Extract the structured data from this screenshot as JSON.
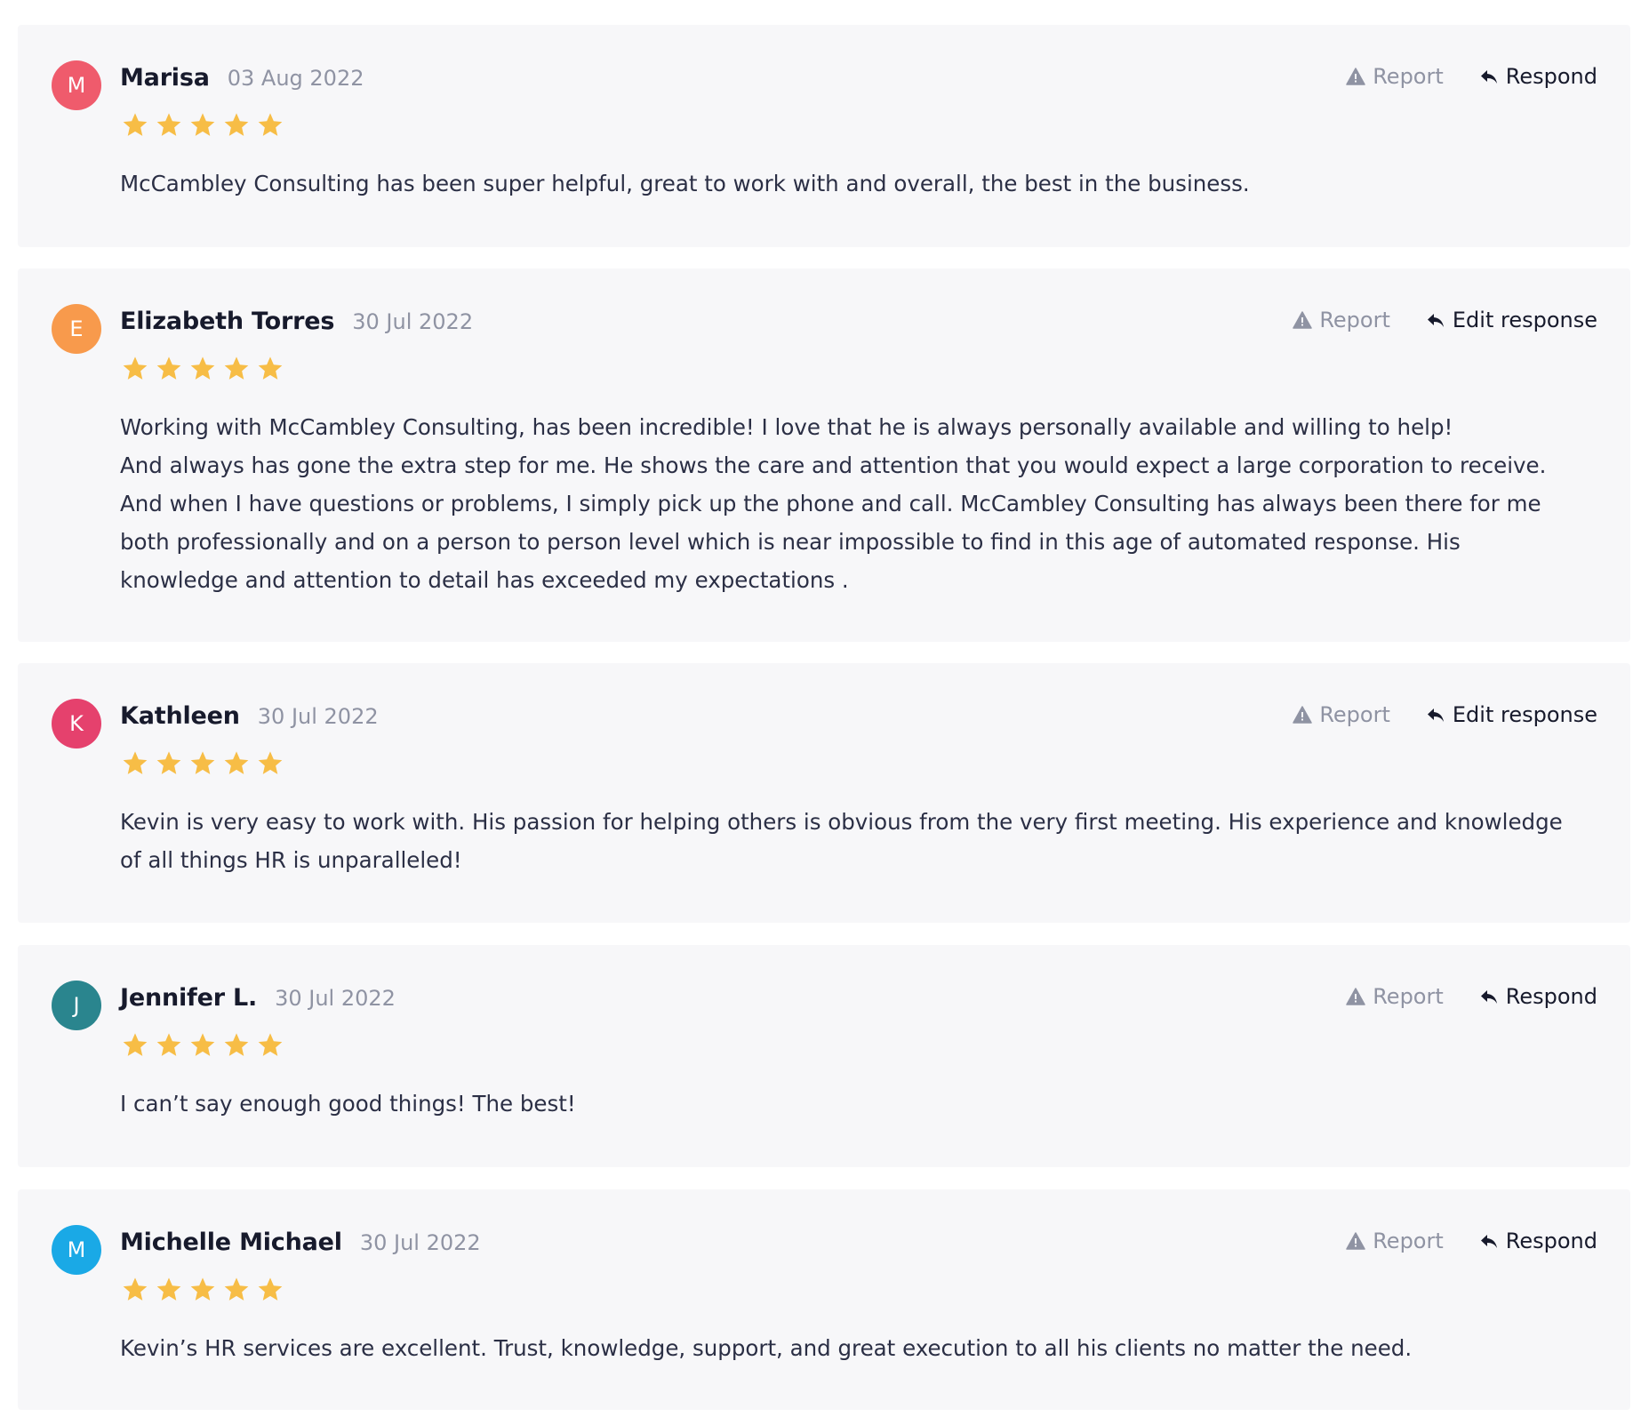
{
  "colors": {
    "star": "#f7bd46",
    "card_background": "#f7f7f9",
    "muted_text": "#8f93a3",
    "dark_text": "#171a2c"
  },
  "reviews": [
    {
      "initial": "M",
      "avatar_color": "#ef5b6c",
      "name": "Marisa",
      "date": "03 Aug 2022",
      "rating": 5,
      "report_label": "Report",
      "response_label": "Respond",
      "text": "McCambley Consulting has been super helpful, great to work with and overall, the best in the business."
    },
    {
      "initial": "E",
      "avatar_color": "#f89a4c",
      "name": "Elizabeth Torres",
      "date": "30 Jul 2022",
      "rating": 5,
      "report_label": "Report",
      "response_label": "Edit response",
      "text": "Working with McCambley Consulting, has been incredible! I love that he is always personally available and willing to help!\nAnd always has gone the extra step for me. He shows the care and attention that you would expect a large corporation to receive. And when I have questions or problems, I simply pick up the phone and call. McCambley Consulting has always been there for me both professionally and on a person to person level which is near impossible to find in this age of automated response. His knowledge and attention to detail has exceeded my expectations ."
    },
    {
      "initial": "K",
      "avatar_color": "#e5416d",
      "name": "Kathleen",
      "date": "30 Jul 2022",
      "rating": 5,
      "report_label": "Report",
      "response_label": "Edit response",
      "text": "Kevin is very easy to work with. His passion for helping others is obvious from the very first meeting. His experience and knowledge of all things HR is unparalleled!"
    },
    {
      "initial": "J",
      "avatar_color": "#2a858e",
      "name": "Jennifer L.",
      "date": "30 Jul 2022",
      "rating": 5,
      "report_label": "Report",
      "response_label": "Respond",
      "text": "I can’t say enough good things! The best!"
    },
    {
      "initial": "M",
      "avatar_color": "#1aa9e6",
      "name": "Michelle Michael",
      "date": "30 Jul 2022",
      "rating": 5,
      "report_label": "Report",
      "response_label": "Respond",
      "text": "Kevin’s HR services are excellent. Trust, knowledge, support, and great execution to all his clients no matter the need."
    }
  ]
}
